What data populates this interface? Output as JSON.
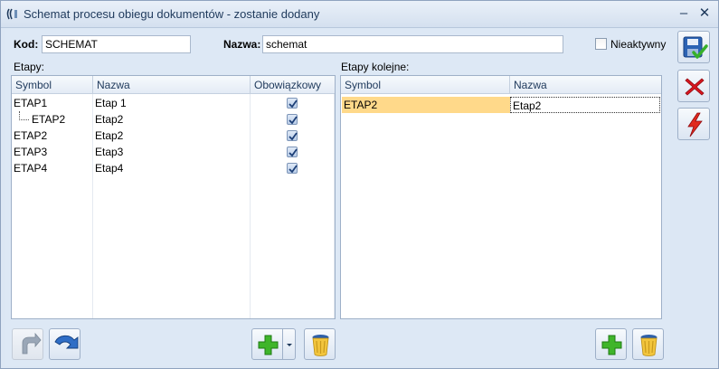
{
  "window": {
    "title": "Schemat procesu obiegu dokumentów - zostanie dodany",
    "minimize_glyph": "–",
    "close_glyph": "✕"
  },
  "form": {
    "kod_label": "Kod:",
    "kod_value": "SCHEMAT",
    "nazwa_label": "Nazwa:",
    "nazwa_value": "schemat",
    "inactive_label": "Nieaktywny",
    "inactive_checked": false
  },
  "etapy": {
    "label": "Etapy:",
    "columns": [
      "Symbol",
      "Nazwa",
      "Obowiązkowy"
    ],
    "rows": [
      {
        "symbol": "ETAP1",
        "nazwa": "Etap 1",
        "obowiazkowy": true,
        "indent": false
      },
      {
        "symbol": "ETAP2",
        "nazwa": "Etap2",
        "obowiazkowy": true,
        "indent": true
      },
      {
        "symbol": "ETAP2",
        "nazwa": "Etap2",
        "obowiazkowy": true,
        "indent": false
      },
      {
        "symbol": "ETAP3",
        "nazwa": "Etap3",
        "obowiazkowy": true,
        "indent": false
      },
      {
        "symbol": "ETAP4",
        "nazwa": "Etap4",
        "obowiazkowy": true,
        "indent": false
      }
    ]
  },
  "kolejne": {
    "label": "Etapy kolejne:",
    "columns": [
      "Symbol",
      "Nazwa"
    ],
    "rows": [
      {
        "symbol": "ETAP2",
        "nazwa": "Etap2",
        "selected": true
      }
    ]
  },
  "colors": {
    "selected_cell": "#ffd98a",
    "accent_green": "#3fb52a",
    "accent_red": "#d8151e",
    "accent_blue": "#1f5fb0"
  },
  "icons": {
    "save": "floppy-disk-check-icon",
    "cancel": "red-x-icon",
    "flash": "lightning-icon",
    "undo": "arrow-back-icon",
    "redo": "arrow-forward-icon",
    "add": "green-plus-icon",
    "delete": "trash-bin-icon"
  }
}
